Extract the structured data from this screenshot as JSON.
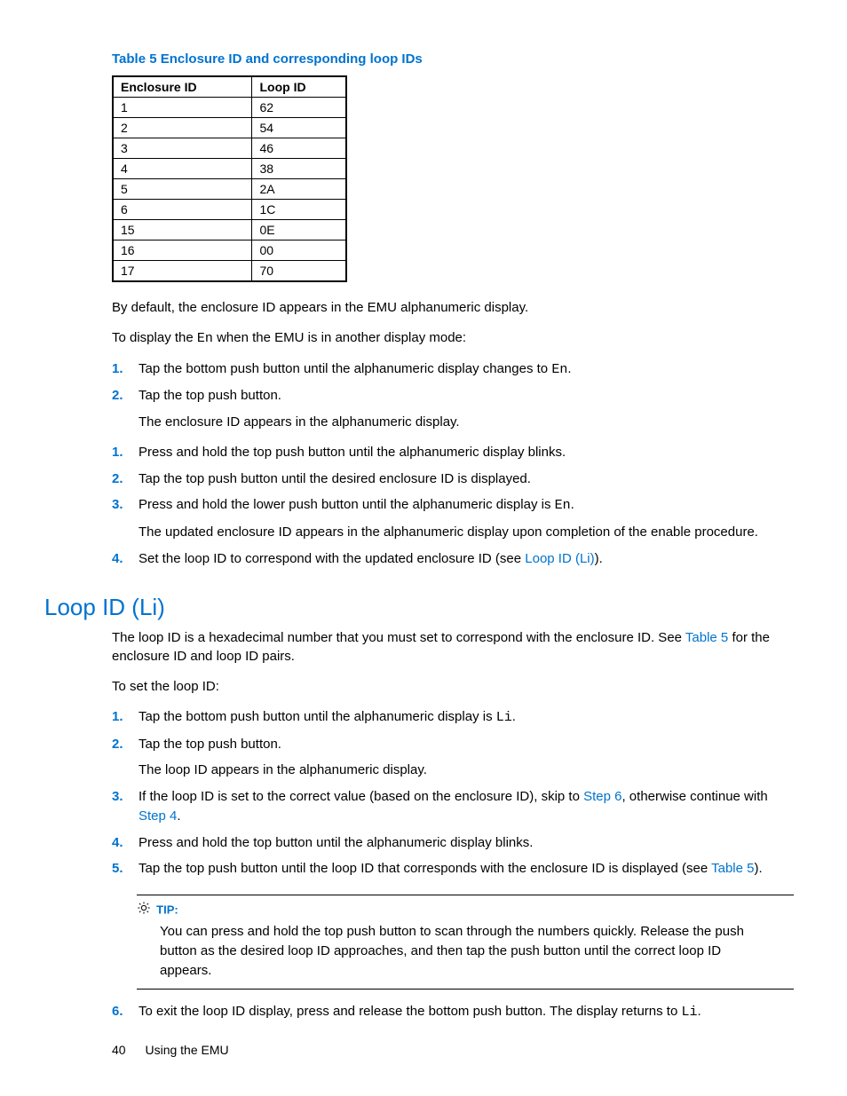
{
  "table": {
    "title": "Table 5 Enclosure ID and corresponding loop IDs",
    "headers": {
      "c1": "Enclosure ID",
      "c2": "Loop ID"
    },
    "rows": [
      {
        "c1": "1",
        "c2": "62"
      },
      {
        "c1": "2",
        "c2": "54"
      },
      {
        "c1": "3",
        "c2": "46"
      },
      {
        "c1": "4",
        "c2": "38"
      },
      {
        "c1": "5",
        "c2": "2A"
      },
      {
        "c1": "6",
        "c2": "1C"
      },
      {
        "c1": "15",
        "c2": "0E"
      },
      {
        "c1": "16",
        "c2": "00"
      },
      {
        "c1": "17",
        "c2": "70"
      }
    ]
  },
  "paragraphs": {
    "p1": "By default, the enclosure ID appears in the EMU alphanumeric display.",
    "p2a": "To display the ",
    "p2_code": "En",
    "p2b": " when the EMU is in another display mode:"
  },
  "list1": {
    "i1a": "Tap the bottom push button until the alphanumeric display changes to ",
    "i1_code": "En",
    "i1b": ".",
    "i2": "Tap the top push button.",
    "i2_sub": "The enclosure ID appears in the alphanumeric display."
  },
  "list2": {
    "i1": "Press and hold the top push button until the alphanumeric display blinks.",
    "i2": "Tap the top push button until the desired enclosure ID is displayed.",
    "i3a": "Press and hold the lower push button until the alphanumeric display is ",
    "i3_code": "En",
    "i3b": ".",
    "i3_sub": "The updated enclosure ID appears in the alphanumeric display upon completion of the enable procedure.",
    "i4a": "Set the loop ID to correspond with the updated enclosure ID (see ",
    "i4_link": "Loop ID (Li)",
    "i4b": ")."
  },
  "section": {
    "heading": "Loop ID (Li)",
    "p1a": "The loop ID is a hexadecimal number that you must set to correspond with the enclosure ID. See ",
    "p1_link": "Table 5",
    "p1b": " for the enclosure ID and loop ID pairs.",
    "p2": "To set the loop ID:"
  },
  "list3": {
    "i1a": "Tap the bottom push button until the alphanumeric display is ",
    "i1_code": "Li",
    "i1b": ".",
    "i2": "Tap the top push button.",
    "i2_sub": "The loop ID appears in the alphanumeric display.",
    "i3a": "If the loop ID is set to the correct value (based on the enclosure ID), skip to ",
    "i3_link1": "Step 6",
    "i3b": ", otherwise continue with ",
    "i3_link2": "Step 4",
    "i3c": ".",
    "i4": "Press and hold the top button until the alphanumeric display blinks.",
    "i5a": "Tap the top push button until the loop ID that corresponds with the enclosure ID is displayed (see ",
    "i5_link": "Table 5",
    "i5b": ").",
    "i6a": "To exit the loop ID display, press and release the bottom push button. The display returns to ",
    "i6_code": "Li",
    "i6b": "."
  },
  "tip": {
    "label": "TIP:",
    "body": "You can press and hold the top push button to scan through the numbers quickly. Release the push button as the desired loop ID approaches, and then tap the push button until the correct loop ID appears."
  },
  "nums": {
    "n1": "1.",
    "n2": "2.",
    "n3": "3.",
    "n4": "4.",
    "n5": "5.",
    "n6": "6."
  },
  "footer": {
    "page": "40",
    "section": "Using the EMU"
  }
}
